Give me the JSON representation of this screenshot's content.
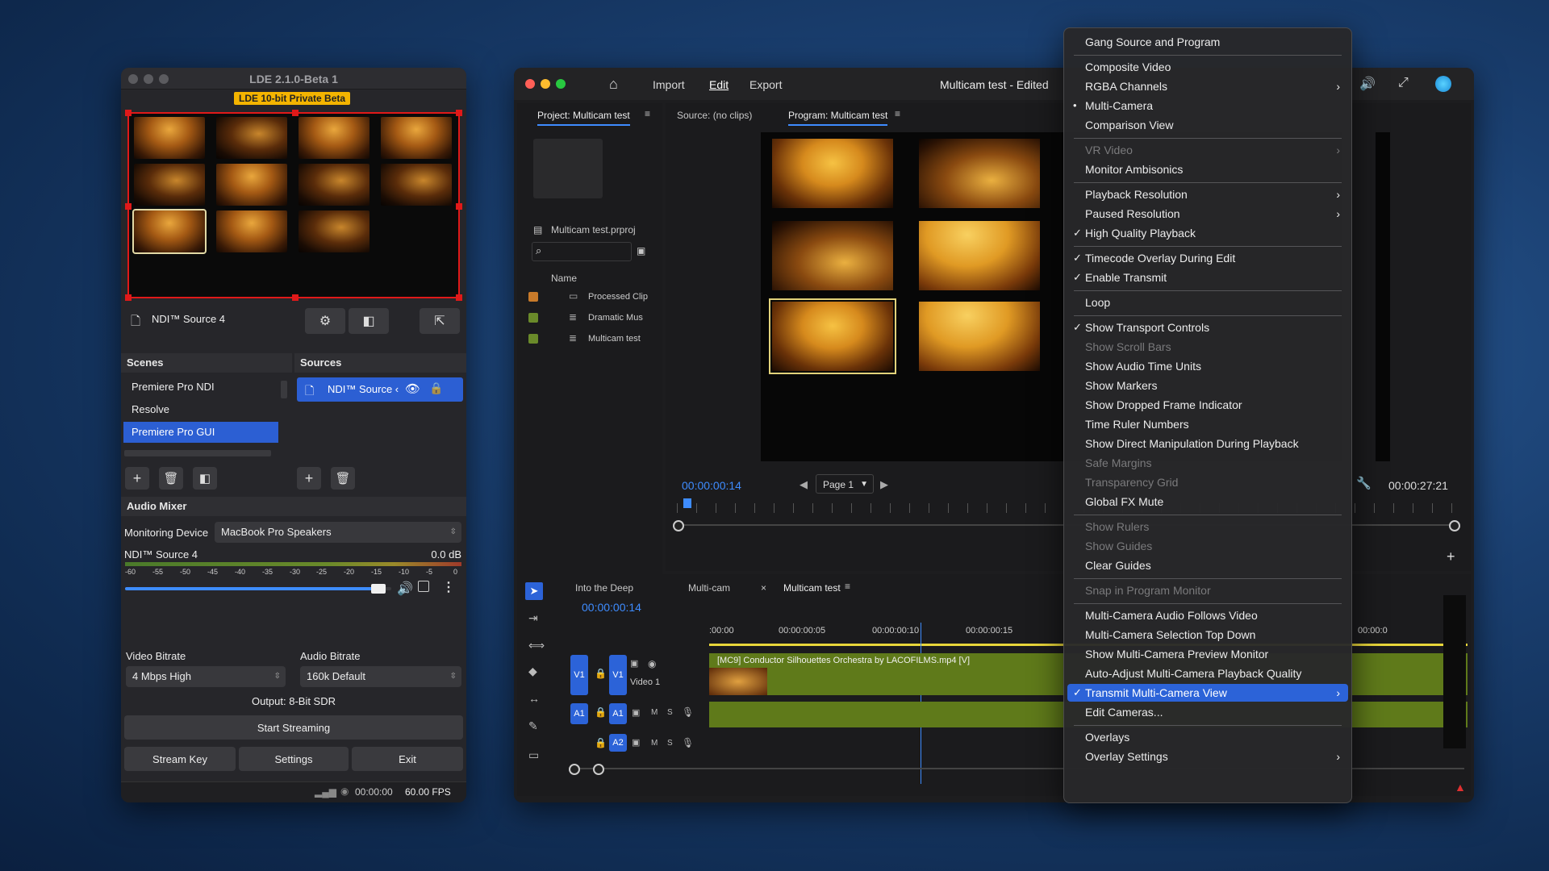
{
  "lde": {
    "window_title": "LDE 2.1.0-Beta 1",
    "beta_badge": "LDE 10-bit Private Beta",
    "source_name": "NDI™ Source 4",
    "scenes_header": "Scenes",
    "sources_header": "Sources",
    "scenes": [
      "Premiere Pro NDI",
      "Resolve",
      "Premiere Pro GUI"
    ],
    "active_scene": "Premiere Pro GUI",
    "source_item": "NDI™ Source ‹",
    "audio_mixer_header": "Audio Mixer",
    "monitoring_label": "Monitoring Device",
    "monitoring_value": "MacBook Pro Speakers",
    "meter_source": "NDI™ Source 4",
    "meter_db": "0.0 dB",
    "meter_ticks": [
      "-60",
      "-55",
      "-50",
      "-45",
      "-40",
      "-35",
      "-30",
      "-25",
      "-20",
      "-15",
      "-10",
      "-5",
      "0"
    ],
    "volume_level": 0.98,
    "video_bitrate_label": "Video Bitrate",
    "video_bitrate_value": "4 Mbps High",
    "audio_bitrate_label": "Audio Bitrate",
    "audio_bitrate_value": "160k Default",
    "output_text": "Output: 8-Bit SDR",
    "start_streaming": "Start Streaming",
    "stream_key": "Stream Key",
    "settings": "Settings",
    "exit": "Exit",
    "status_time": "00:00:00",
    "status_fps": "60.00 FPS"
  },
  "premiere": {
    "menus": [
      "Import",
      "Edit",
      "Export"
    ],
    "active_menu": "Edit",
    "window_title": "Multicam test - Edited",
    "project_tab": "Project: Multicam test",
    "source_tab": "Source: (no clips)",
    "program_tab": "Program: Multicam test",
    "project_file": "Multicam test.prproj",
    "name_header": "Name",
    "bin_items": [
      {
        "label": "Processed Clip",
        "color": "#c87a2a"
      },
      {
        "label": "Dramatic Mus",
        "color": "#6a8a2a"
      },
      {
        "label": "Multicam test",
        "color": "#6a8a2a"
      }
    ],
    "program_timecode": "00:00:00:14",
    "page_select": "Page 1",
    "duration_timecode": "00:00:27:21",
    "seq_tabs": [
      "Into the Deep",
      "Multi-cam",
      "Multicam test"
    ],
    "timeline_timecode": "00:00:00:14",
    "ruler_labels": [
      ":00:00",
      "00:00:00:05",
      "00:00:00:10",
      "00:00:00:15",
      "00:00:0"
    ],
    "clip_label": "[MC9] Conductor Silhouettes Orchestra by LACOFILMS.mp4 [V]",
    "tracks": {
      "v1": "V1",
      "video1": "Video 1",
      "a1": "A1",
      "a2": "A2",
      "m": "M",
      "s": "S"
    }
  },
  "context_menu": [
    {
      "label": "Gang Source and Program"
    },
    {
      "sep": true
    },
    {
      "label": "Composite Video"
    },
    {
      "label": "RGBA Channels",
      "submenu": true
    },
    {
      "label": "Multi-Camera",
      "mark": "•"
    },
    {
      "label": "Comparison View"
    },
    {
      "sep": true
    },
    {
      "label": "VR Video",
      "submenu": true,
      "disabled": true
    },
    {
      "label": "Monitor Ambisonics"
    },
    {
      "sep": true
    },
    {
      "label": "Playback Resolution",
      "submenu": true
    },
    {
      "label": "Paused Resolution",
      "submenu": true
    },
    {
      "label": "High Quality Playback",
      "mark": "✓"
    },
    {
      "sep": true
    },
    {
      "label": "Timecode Overlay During Edit",
      "mark": "✓"
    },
    {
      "label": "Enable Transmit",
      "mark": "✓"
    },
    {
      "sep": true
    },
    {
      "label": "Loop"
    },
    {
      "sep": true
    },
    {
      "label": "Show Transport Controls",
      "mark": "✓"
    },
    {
      "label": "Show Scroll Bars",
      "disabled": true
    },
    {
      "label": "Show Audio Time Units"
    },
    {
      "label": "Show Markers"
    },
    {
      "label": "Show Dropped Frame Indicator"
    },
    {
      "label": "Time Ruler Numbers"
    },
    {
      "label": "Show Direct Manipulation During Playback"
    },
    {
      "label": "Safe Margins",
      "disabled": true
    },
    {
      "label": "Transparency Grid",
      "disabled": true
    },
    {
      "label": "Global FX Mute"
    },
    {
      "sep": true
    },
    {
      "label": "Show Rulers",
      "disabled": true
    },
    {
      "label": "Show Guides",
      "disabled": true
    },
    {
      "label": "Clear Guides"
    },
    {
      "sep": true
    },
    {
      "label": "Snap in Program Monitor",
      "disabled": true
    },
    {
      "sep": true
    },
    {
      "label": "Multi-Camera Audio Follows Video"
    },
    {
      "label": "Multi-Camera Selection Top Down"
    },
    {
      "label": "Show Multi-Camera Preview Monitor"
    },
    {
      "label": "Auto-Adjust Multi-Camera Playback Quality"
    },
    {
      "label": "Transmit Multi-Camera View",
      "mark": "✓",
      "highlighted": true,
      "submenu": true
    },
    {
      "label": "Edit Cameras..."
    },
    {
      "sep": true
    },
    {
      "label": "Overlays"
    },
    {
      "label": "Overlay Settings",
      "submenu": true
    }
  ]
}
